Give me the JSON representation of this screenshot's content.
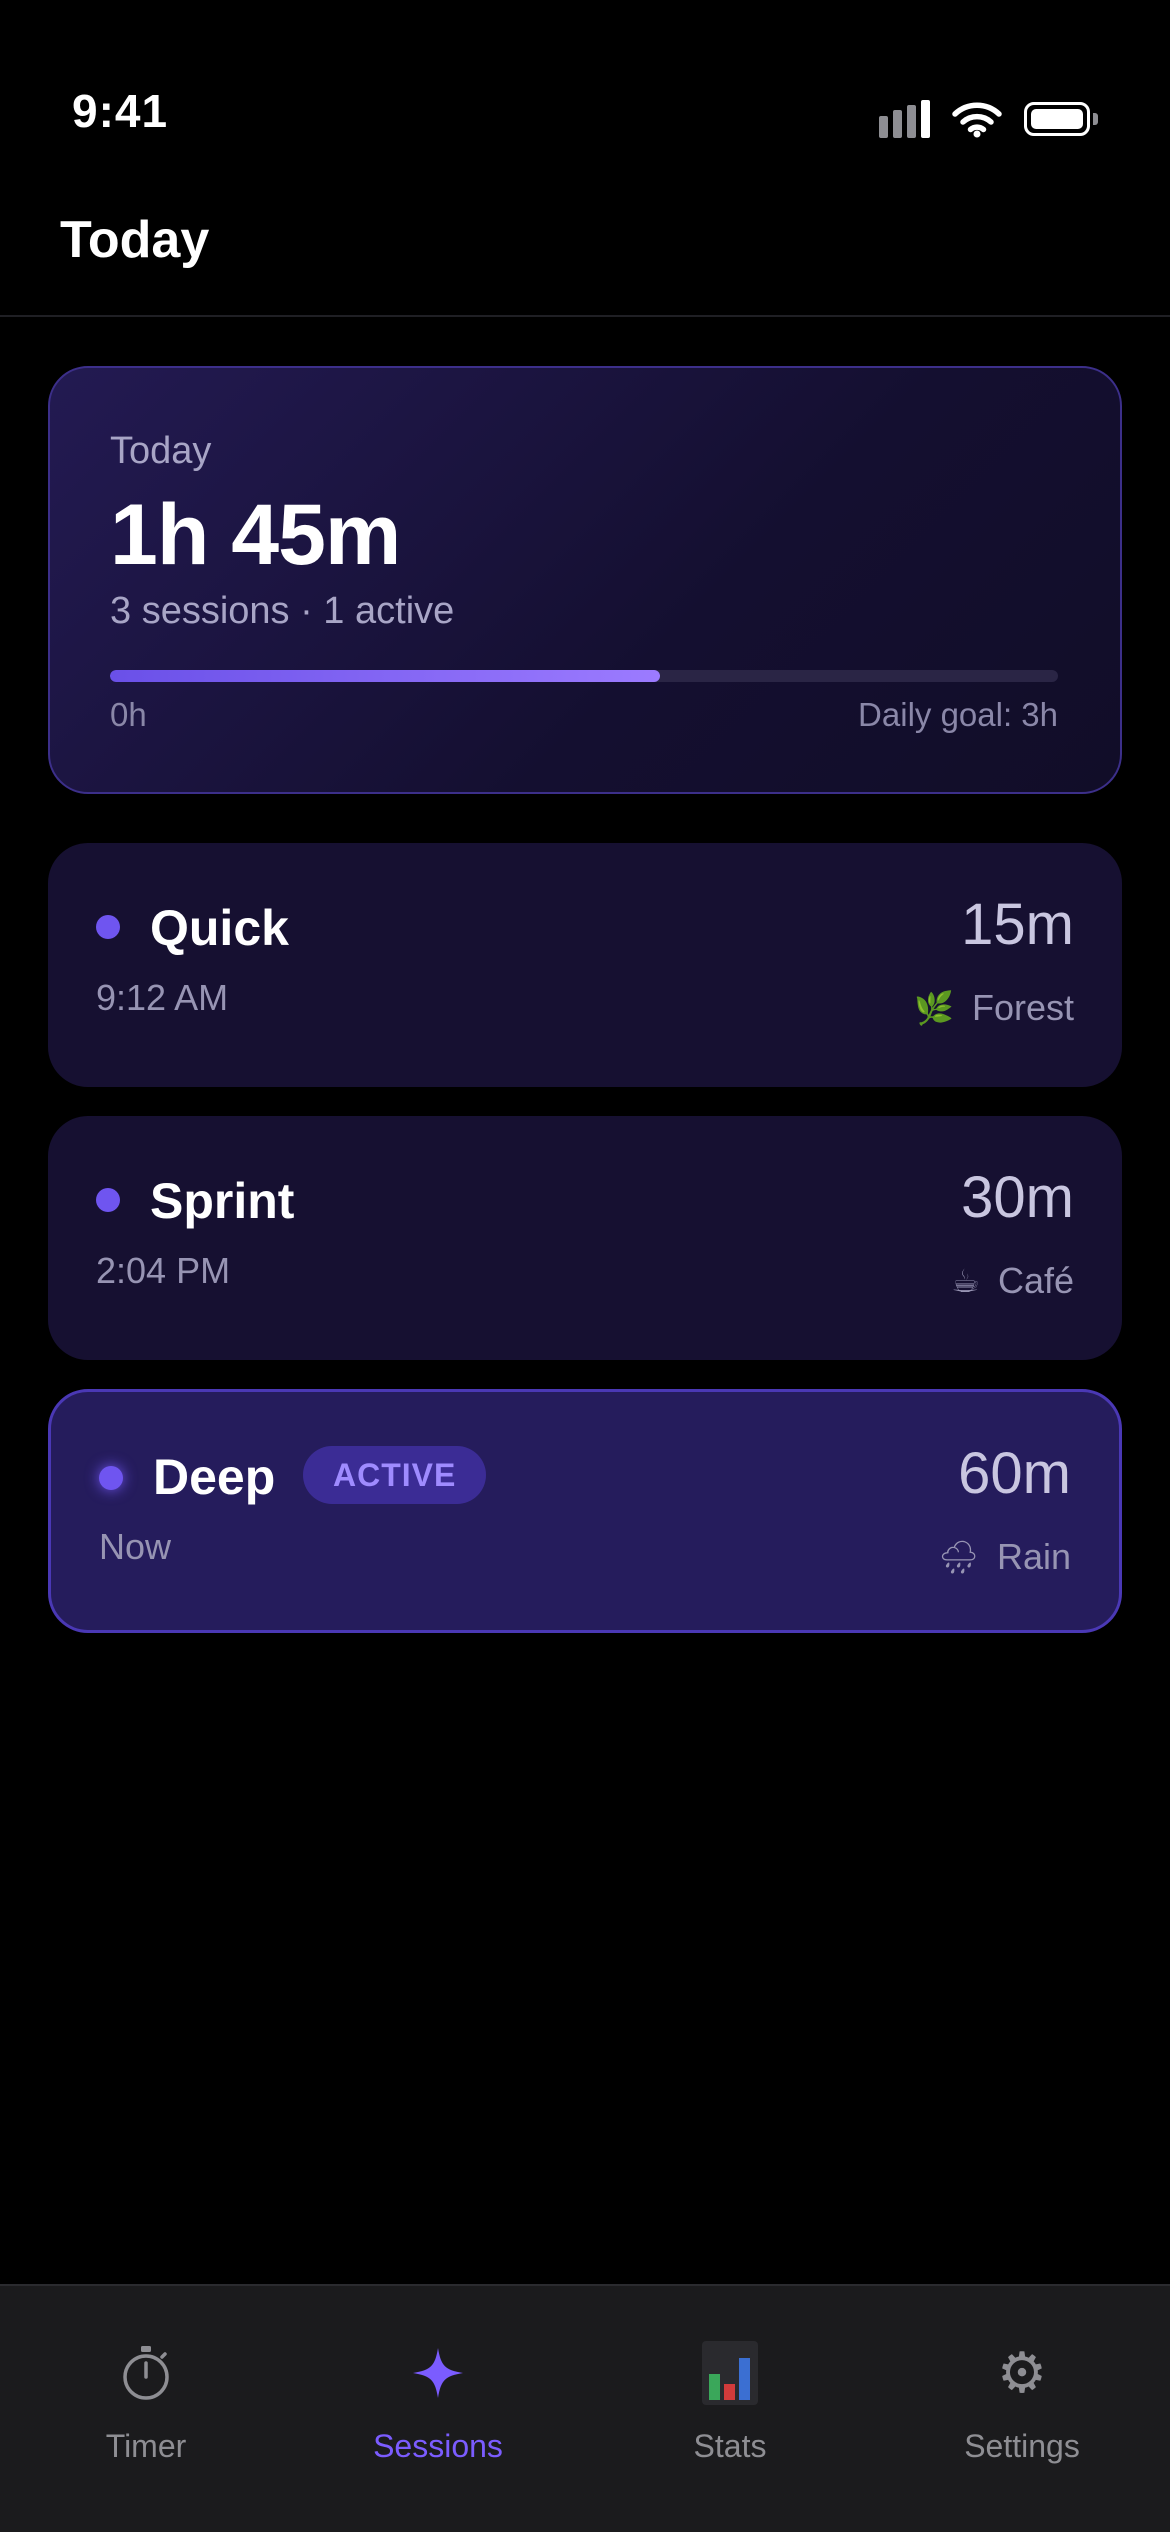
{
  "status_bar": {
    "time": "9:41"
  },
  "header": {
    "title": "Today"
  },
  "summary": {
    "label": "Today",
    "total": "1h 45m",
    "subtitle": "3 sessions · 1 active",
    "progress_fraction": 0.58,
    "progress_min_label": "0h",
    "goal_label": "Daily goal: 3h"
  },
  "sessions": [
    {
      "name": "Quick",
      "time": "9:12 AM",
      "duration": "15m",
      "sound": "Forest",
      "sound_icon": "leaf-icon",
      "active": false
    },
    {
      "name": "Sprint",
      "time": "2:04 PM",
      "duration": "30m",
      "sound": "Café",
      "sound_icon": "coffee-icon",
      "active": false
    },
    {
      "name": "Deep",
      "time": "Now",
      "duration": "60m",
      "sound": "Rain",
      "sound_icon": "rain-cloud-icon",
      "active": true,
      "badge": "ACTIVE"
    }
  ],
  "tabs": [
    {
      "label": "Timer",
      "icon": "stopwatch-icon",
      "selected": false
    },
    {
      "label": "Sessions",
      "icon": "sparkle-icon",
      "selected": true
    },
    {
      "label": "Stats",
      "icon": "bar-chart-icon",
      "selected": false
    },
    {
      "label": "Settings",
      "icon": "gear-icon",
      "selected": false
    }
  ],
  "colors": {
    "accent": "#7b5cff",
    "background": "#000000",
    "card": "#161031",
    "active_card": "#251c5c"
  }
}
